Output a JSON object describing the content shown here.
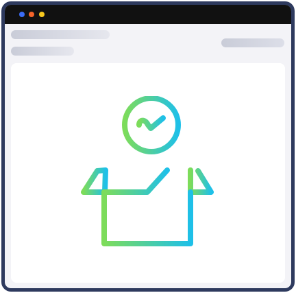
{
  "window": {
    "dots": [
      {
        "name": "close",
        "color": "#3b6cf6"
      },
      {
        "name": "minimize",
        "color": "#f5642a"
      },
      {
        "name": "maximize",
        "color": "#f7c81f"
      }
    ],
    "frame_color": "#2e3a5e",
    "titlebar_color": "#111111"
  },
  "illustration": {
    "icon": "package-delivered-checkmark-icon",
    "gradient_start": "#7ddc5a",
    "gradient_end": "#1ec0e8"
  }
}
